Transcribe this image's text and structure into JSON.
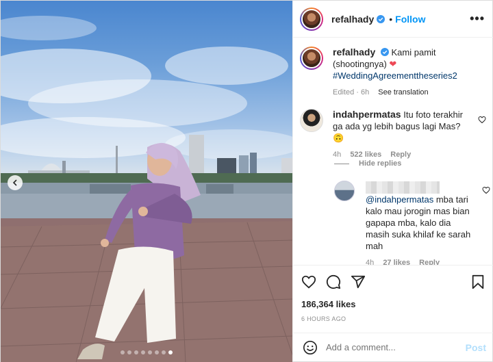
{
  "post": {
    "username": "refalhady",
    "follow_label": "Follow",
    "more_label": "•••"
  },
  "caption": {
    "username": "refalhady",
    "text": "Kami pamit (shootingnya)",
    "emoji": "❤",
    "hashtag": "#WeddingAgreementtheseries2",
    "edited": "Edited · 6h",
    "see_translation": "See translation"
  },
  "comments": [
    {
      "username": "indahpermatas",
      "text": "Itu foto terakhir ga ada yg lebih bagus lagi Mas?",
      "emoji": "🙃",
      "time": "4h",
      "likes": "522 likes",
      "reply": "Reply"
    }
  ],
  "hide_replies_label": "Hide replies",
  "reply": {
    "mention": "@indahpermatas",
    "text": "mba tari kalo mau jorogin mas bian gapapa mba, kalo dia masih suka khilaf ke sarah mah",
    "time": "4h",
    "likes": "27 likes",
    "reply": "Reply"
  },
  "stats": {
    "likes": "186,364 likes",
    "time_ago": "6 HOURS AGO"
  },
  "add_comment": {
    "placeholder": "Add a comment...",
    "post_label": "Post"
  },
  "carousel": {
    "dot_count": 8,
    "active_index": 7
  },
  "icons": {
    "verified": "verified-badge-icon",
    "heart": "heart-icon",
    "comment": "comment-icon",
    "share": "share-icon",
    "bookmark": "bookmark-icon",
    "emoji": "emoji-icon",
    "prev": "chevron-left-icon"
  },
  "colors": {
    "accent": "#0095f6",
    "heart_red": "#ed4956",
    "meta_gray": "#8e8e8e",
    "post_disabled": "#b2dffc"
  }
}
